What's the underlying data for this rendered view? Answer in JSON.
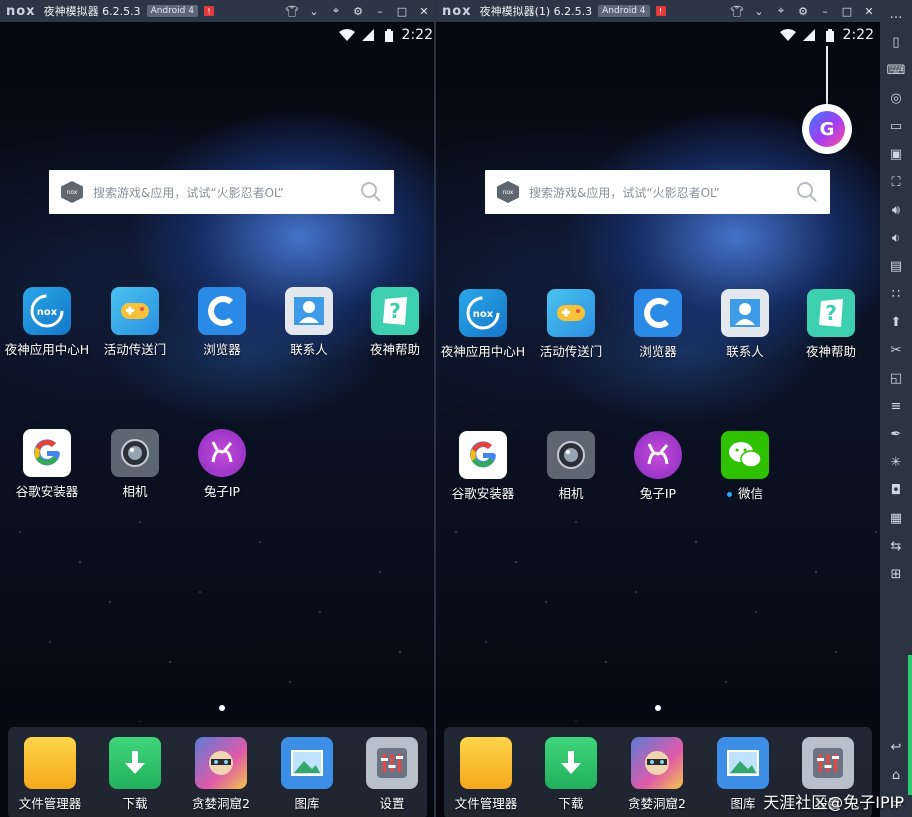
{
  "colors": {
    "titlebar": "#2d3646",
    "toolbar": "#2b3442",
    "accent_green": "#2ecc71",
    "alert_red": "#e23b3b"
  },
  "windows": [
    {
      "id": "left",
      "title": "夜神模拟器 6.2.5.3",
      "logo": "nox",
      "android_badge": "Android 4",
      "alert_badge": "!",
      "time": "2:22",
      "search_placeholder": "搜索游戏&应用，试试“火影忍者OL”",
      "apps_row1": [
        "夜神应用中心H",
        "活动传送门",
        "浏览器",
        "联系人",
        "夜神帮助"
      ],
      "apps_row2": [
        "谷歌安装器",
        "相机",
        "兔子IP"
      ],
      "dock": [
        "文件管理器",
        "下载",
        "贪婪洞窟2",
        "图库",
        "设置"
      ]
    },
    {
      "id": "right",
      "title": "夜神模拟器(1) 6.2.5.3",
      "logo": "nox",
      "android_badge": "Android 4",
      "alert_badge": "!",
      "time": "2:22",
      "search_placeholder": "搜索游戏&应用，试试“火影忍者OL”",
      "apps_row1": [
        "夜神应用中心H",
        "活动传送门",
        "浏览器",
        "联系人",
        "夜神帮助"
      ],
      "apps_row2": [
        "谷歌安装器",
        "相机",
        "兔子IP",
        "微信"
      ],
      "dock": [
        "文件管理器",
        "下载",
        "贪婪洞窟2",
        "图库",
        "设置"
      ],
      "floating_button": "G"
    }
  ],
  "watermark": "天涯社区@兔子IPIP",
  "side_toolbar_icons": [
    "more-icon",
    "phone-shake-icon",
    "keyboard-icon",
    "location-icon",
    "screen-icon",
    "apk-install-icon",
    "fullscreen-icon",
    "volume-up-icon",
    "volume-down-icon",
    "multi-instance-icon",
    "shake-icon",
    "screenshot-icon",
    "scissors-icon",
    "sync-icon",
    "menu-icon",
    "macro-icon",
    "loading-icon",
    "robot-icon",
    "transfer-icon",
    "plugin-icon",
    "back-icon",
    "home-icon",
    "recent-apps-icon"
  ]
}
